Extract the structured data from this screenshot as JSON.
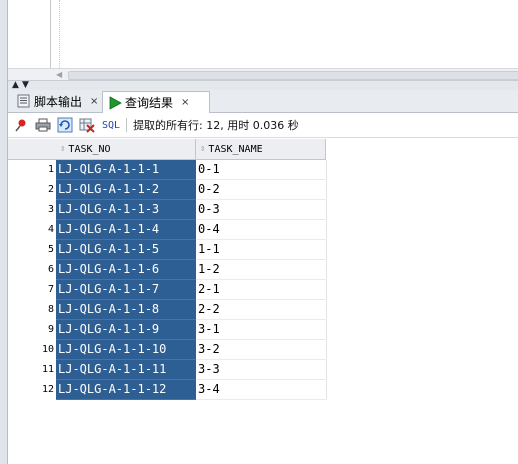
{
  "tabs": [
    {
      "label": "脚本输出",
      "icon": "script-output-icon",
      "close": "×"
    },
    {
      "label": "查询结果",
      "icon": "run-play-icon",
      "close": "×"
    }
  ],
  "toolbar": {
    "sql_label": "SQL",
    "status_text": "提取的所有行: 12, 用时 0.036 秒"
  },
  "grid": {
    "columns": [
      "TASK_NO",
      "TASK_NAME"
    ],
    "rows": [
      {
        "n": "1",
        "task_no": "LJ-QLG-A-1-1-1",
        "task_name": "0-1"
      },
      {
        "n": "2",
        "task_no": "LJ-QLG-A-1-1-2",
        "task_name": "0-2"
      },
      {
        "n": "3",
        "task_no": "LJ-QLG-A-1-1-3",
        "task_name": "0-3"
      },
      {
        "n": "4",
        "task_no": "LJ-QLG-A-1-1-4",
        "task_name": "0-4"
      },
      {
        "n": "5",
        "task_no": "LJ-QLG-A-1-1-5",
        "task_name": "1-1"
      },
      {
        "n": "6",
        "task_no": "LJ-QLG-A-1-1-6",
        "task_name": "1-2"
      },
      {
        "n": "7",
        "task_no": "LJ-QLG-A-1-1-7",
        "task_name": "2-1"
      },
      {
        "n": "8",
        "task_no": "LJ-QLG-A-1-1-8",
        "task_name": "2-2"
      },
      {
        "n": "9",
        "task_no": "LJ-QLG-A-1-1-9",
        "task_name": "3-1"
      },
      {
        "n": "10",
        "task_no": "LJ-QLG-A-1-1-10",
        "task_name": "3-2"
      },
      {
        "n": "11",
        "task_no": "LJ-QLG-A-1-1-11",
        "task_name": "3-3"
      },
      {
        "n": "12",
        "task_no": "LJ-QLG-A-1-1-12",
        "task_name": "3-4"
      }
    ]
  },
  "colors": {
    "selection": "#2e5f94",
    "accent_green": "#1e9a2a"
  }
}
